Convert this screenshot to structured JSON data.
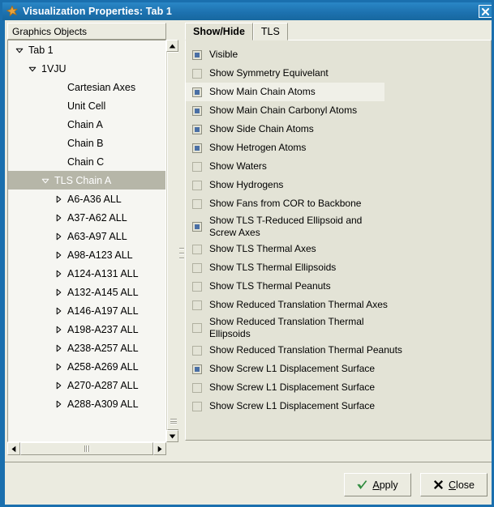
{
  "window": {
    "title": "Visualization Properties: Tab 1",
    "star_icon": "star-icon",
    "close_icon": "close-icon"
  },
  "colors": {
    "titlebar": "#1d72b0",
    "face": "#ebebe0",
    "panel": "#e3e3d6",
    "tree_bg": "#f6f6f2",
    "selection": "#b6b6a8",
    "checkbox_fill": "#4a6fa5",
    "apply_check": "#2e8b3d"
  },
  "tree": {
    "header_label": "Graphics Objects",
    "nodes": [
      {
        "label": "Tab 1",
        "indent": 0,
        "expander": "down",
        "selected": false
      },
      {
        "label": "1VJU",
        "indent": 1,
        "expander": "down",
        "selected": false
      },
      {
        "label": "Cartesian Axes",
        "indent": 3,
        "expander": "none",
        "selected": false
      },
      {
        "label": "Unit Cell",
        "indent": 3,
        "expander": "none",
        "selected": false
      },
      {
        "label": "Chain A",
        "indent": 3,
        "expander": "none",
        "selected": false
      },
      {
        "label": "Chain B",
        "indent": 3,
        "expander": "none",
        "selected": false
      },
      {
        "label": "Chain C",
        "indent": 3,
        "expander": "none",
        "selected": false
      },
      {
        "label": "TLS Chain A",
        "indent": 2,
        "expander": "down",
        "selected": true
      },
      {
        "label": "A6-A36 ALL",
        "indent": 3,
        "expander": "right",
        "selected": false
      },
      {
        "label": "A37-A62 ALL",
        "indent": 3,
        "expander": "right",
        "selected": false
      },
      {
        "label": "A63-A97 ALL",
        "indent": 3,
        "expander": "right",
        "selected": false
      },
      {
        "label": "A98-A123 ALL",
        "indent": 3,
        "expander": "right",
        "selected": false
      },
      {
        "label": "A124-A131 ALL",
        "indent": 3,
        "expander": "right",
        "selected": false
      },
      {
        "label": "A132-A145 ALL",
        "indent": 3,
        "expander": "right",
        "selected": false
      },
      {
        "label": "A146-A197 ALL",
        "indent": 3,
        "expander": "right",
        "selected": false
      },
      {
        "label": "A198-A237 ALL",
        "indent": 3,
        "expander": "right",
        "selected": false
      },
      {
        "label": "A238-A257 ALL",
        "indent": 3,
        "expander": "right",
        "selected": false
      },
      {
        "label": "A258-A269 ALL",
        "indent": 3,
        "expander": "right",
        "selected": false
      },
      {
        "label": "A270-A287 ALL",
        "indent": 3,
        "expander": "right",
        "selected": false
      },
      {
        "label": "A288-A309 ALL",
        "indent": 3,
        "expander": "right",
        "selected": false
      }
    ]
  },
  "tabs": [
    {
      "label": "Show/Hide",
      "active": true
    },
    {
      "label": "TLS",
      "active": false
    }
  ],
  "show_hide": {
    "options": [
      {
        "label": "Visible",
        "checked": true,
        "highlighted": false,
        "wrap": false
      },
      {
        "label": "Show Symmetry Equivelant",
        "checked": false,
        "highlighted": false,
        "wrap": false
      },
      {
        "label": "Show Main Chain Atoms",
        "checked": true,
        "highlighted": true,
        "wrap": false
      },
      {
        "label": "Show Main Chain Carbonyl Atoms",
        "checked": true,
        "highlighted": false,
        "wrap": false
      },
      {
        "label": "Show Side Chain Atoms",
        "checked": true,
        "highlighted": false,
        "wrap": false
      },
      {
        "label": "Show Hetrogen Atoms",
        "checked": true,
        "highlighted": false,
        "wrap": false
      },
      {
        "label": "Show Waters",
        "checked": false,
        "highlighted": false,
        "wrap": false
      },
      {
        "label": "Show Hydrogens",
        "checked": false,
        "highlighted": false,
        "wrap": false
      },
      {
        "label": "Show Fans from COR to Backbone",
        "checked": false,
        "highlighted": false,
        "wrap": false
      },
      {
        "label": "Show TLS T-Reduced Ellipsoid and Screw Axes",
        "checked": true,
        "highlighted": false,
        "wrap": true
      },
      {
        "label": "Show TLS Thermal Axes",
        "checked": false,
        "highlighted": false,
        "wrap": false
      },
      {
        "label": "Show TLS Thermal Ellipsoids",
        "checked": false,
        "highlighted": false,
        "wrap": false
      },
      {
        "label": "Show TLS Thermal Peanuts",
        "checked": false,
        "highlighted": false,
        "wrap": false
      },
      {
        "label": "Show Reduced Translation Thermal Axes",
        "checked": false,
        "highlighted": false,
        "wrap": false
      },
      {
        "label": "Show Reduced Translation Thermal Ellipsoids",
        "checked": false,
        "highlighted": false,
        "wrap": true
      },
      {
        "label": "Show Reduced Translation Thermal Peanuts",
        "checked": false,
        "highlighted": false,
        "wrap": false
      },
      {
        "label": "Show Screw L1 Displacement Surface",
        "checked": true,
        "highlighted": false,
        "wrap": false
      },
      {
        "label": "Show Screw L1 Displacement Surface",
        "checked": false,
        "highlighted": false,
        "wrap": false
      },
      {
        "label": "Show Screw L1 Displacement Surface",
        "checked": false,
        "highlighted": false,
        "wrap": false
      }
    ]
  },
  "buttons": {
    "apply": {
      "label_prefix": "",
      "mnemonic": "A",
      "label_rest": "pply",
      "icon": "check-icon"
    },
    "close": {
      "label_prefix": "",
      "mnemonic": "C",
      "label_rest": "lose",
      "icon": "x-icon"
    }
  },
  "scrollbars": {
    "tree_up_icon": "triangle-up-icon",
    "tree_down_icon": "triangle-down-icon",
    "tree_left_icon": "triangle-left-icon",
    "tree_right_icon": "triangle-right-icon"
  }
}
